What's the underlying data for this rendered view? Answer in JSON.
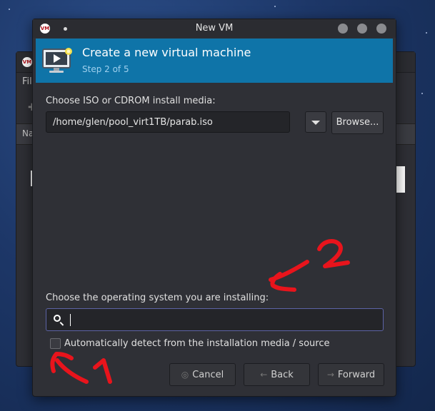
{
  "background_window": {
    "menu_fragment": "Fil",
    "header_fragment": "Na"
  },
  "dialog": {
    "title": "New VM",
    "app_logo_text": "VM",
    "banner": {
      "title": "Create a new virtual machine",
      "step": "Step 2 of 5"
    },
    "install_media": {
      "label": "Choose ISO or CDROM install media:",
      "value": "/home/glen/pool_virt1TB/parab.iso",
      "browse_label": "Browse..."
    },
    "os": {
      "label": "Choose the operating system you are installing:",
      "search_value": "",
      "auto_detect_label": "Automatically detect from the installation media / source",
      "auto_detect_checked": false
    },
    "buttons": {
      "cancel": "Cancel",
      "back": "Back",
      "forward": "Forward"
    }
  },
  "annotations": {
    "mark_1": "1",
    "mark_2": "2",
    "color": "#e8141c"
  },
  "colors": {
    "banner": "#0f74a8",
    "search_focus_border": "#5c63a6"
  }
}
